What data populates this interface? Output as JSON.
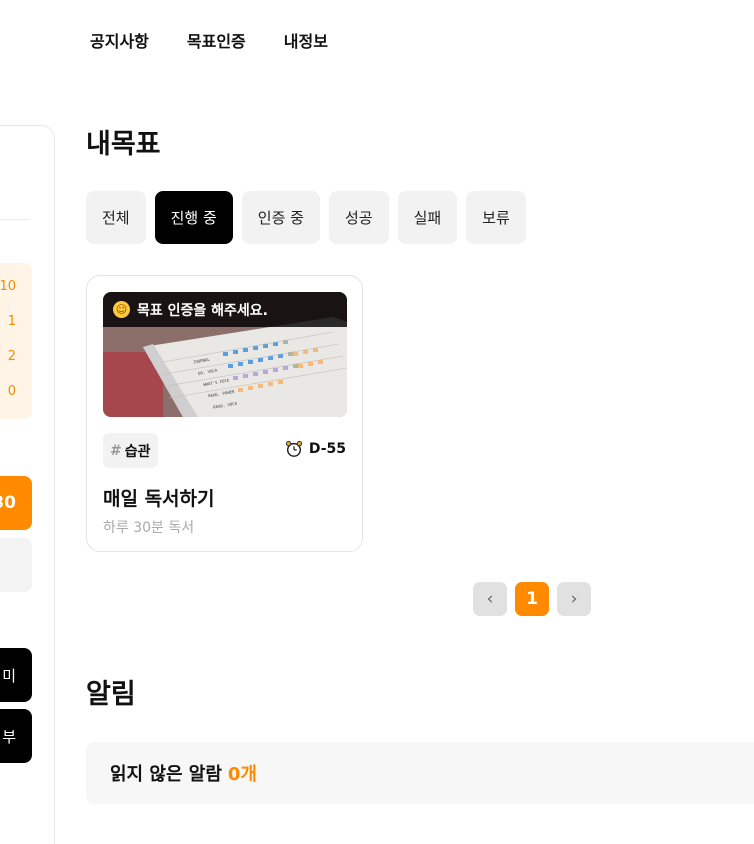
{
  "nav": {
    "items": [
      "공지사항",
      "목표인증",
      "내정보"
    ]
  },
  "sidebar": {
    "stats": [
      "10",
      "1",
      "2",
      "0"
    ],
    "highlight_value": "30",
    "button1_label": "미",
    "button2_label": "부"
  },
  "goals": {
    "title": "내목표",
    "filters": [
      "전체",
      "진행 중",
      "인증 중",
      "성공",
      "실패",
      "보류"
    ],
    "active_filter": "진행 중",
    "card": {
      "banner": "목표 인증을 해주세요.",
      "tag": "습관",
      "tag_prefix": "#",
      "dday": "D-55",
      "title": "매일 독서하기",
      "subtitle": "하루 30분 독서",
      "thumb_labels": [
        "JOURNAL",
        "DO. VOCA",
        "WHAT'S FOTE",
        "READ. POWER",
        "READ. VOCA"
      ]
    },
    "pagination": {
      "prev": "‹",
      "current": "1",
      "next": "›"
    }
  },
  "alerts": {
    "title": "알림",
    "unread_label": "읽지 않은 알람",
    "unread_count": "0개"
  },
  "colors": {
    "accent": "#ff8a00",
    "active_filter_bg": "#000000"
  },
  "icons": [
    "smile-icon",
    "alarm-clock-icon",
    "chevron-left-icon",
    "chevron-right-icon"
  ]
}
